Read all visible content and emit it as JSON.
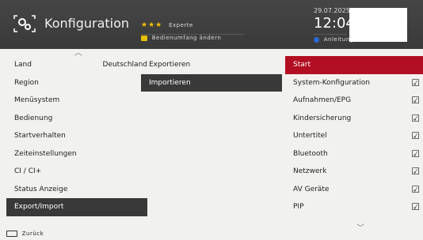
{
  "header": {
    "title": "Konfiguration",
    "stars": "★★★",
    "level": "Experte",
    "scope_button": "Bedienumfang ändern",
    "date": "29.07.2025",
    "time": "12:04",
    "guide": "Anleitung"
  },
  "left_menu": [
    {
      "label": "Land",
      "value": "Deutschland"
    },
    {
      "label": "Region",
      "value": ""
    },
    {
      "label": "Menüsystem",
      "value": ""
    },
    {
      "label": "Bedienung",
      "value": ""
    },
    {
      "label": "Startverhalten",
      "value": ""
    },
    {
      "label": "Zeiteinstellungen",
      "value": ""
    },
    {
      "label": "CI / CI+",
      "value": ""
    },
    {
      "label": "Status Anzeige",
      "value": ""
    },
    {
      "label": "Export/Import",
      "value": ""
    }
  ],
  "middle_menu": [
    {
      "label": "Exportieren"
    },
    {
      "label": "Importieren"
    }
  ],
  "right_menu": [
    {
      "label": "Start"
    },
    {
      "label": "System-Konfiguration"
    },
    {
      "label": "Aufnahmen/EPG"
    },
    {
      "label": "Kindersicherung"
    },
    {
      "label": "Untertitel"
    },
    {
      "label": "Bluetooth"
    },
    {
      "label": "Netzwerk"
    },
    {
      "label": "AV Geräte"
    },
    {
      "label": "PIP"
    }
  ],
  "footer": {
    "back": "Zurück"
  },
  "colors": {
    "accent_red": "#b20f23",
    "selection_dark": "#393939"
  }
}
